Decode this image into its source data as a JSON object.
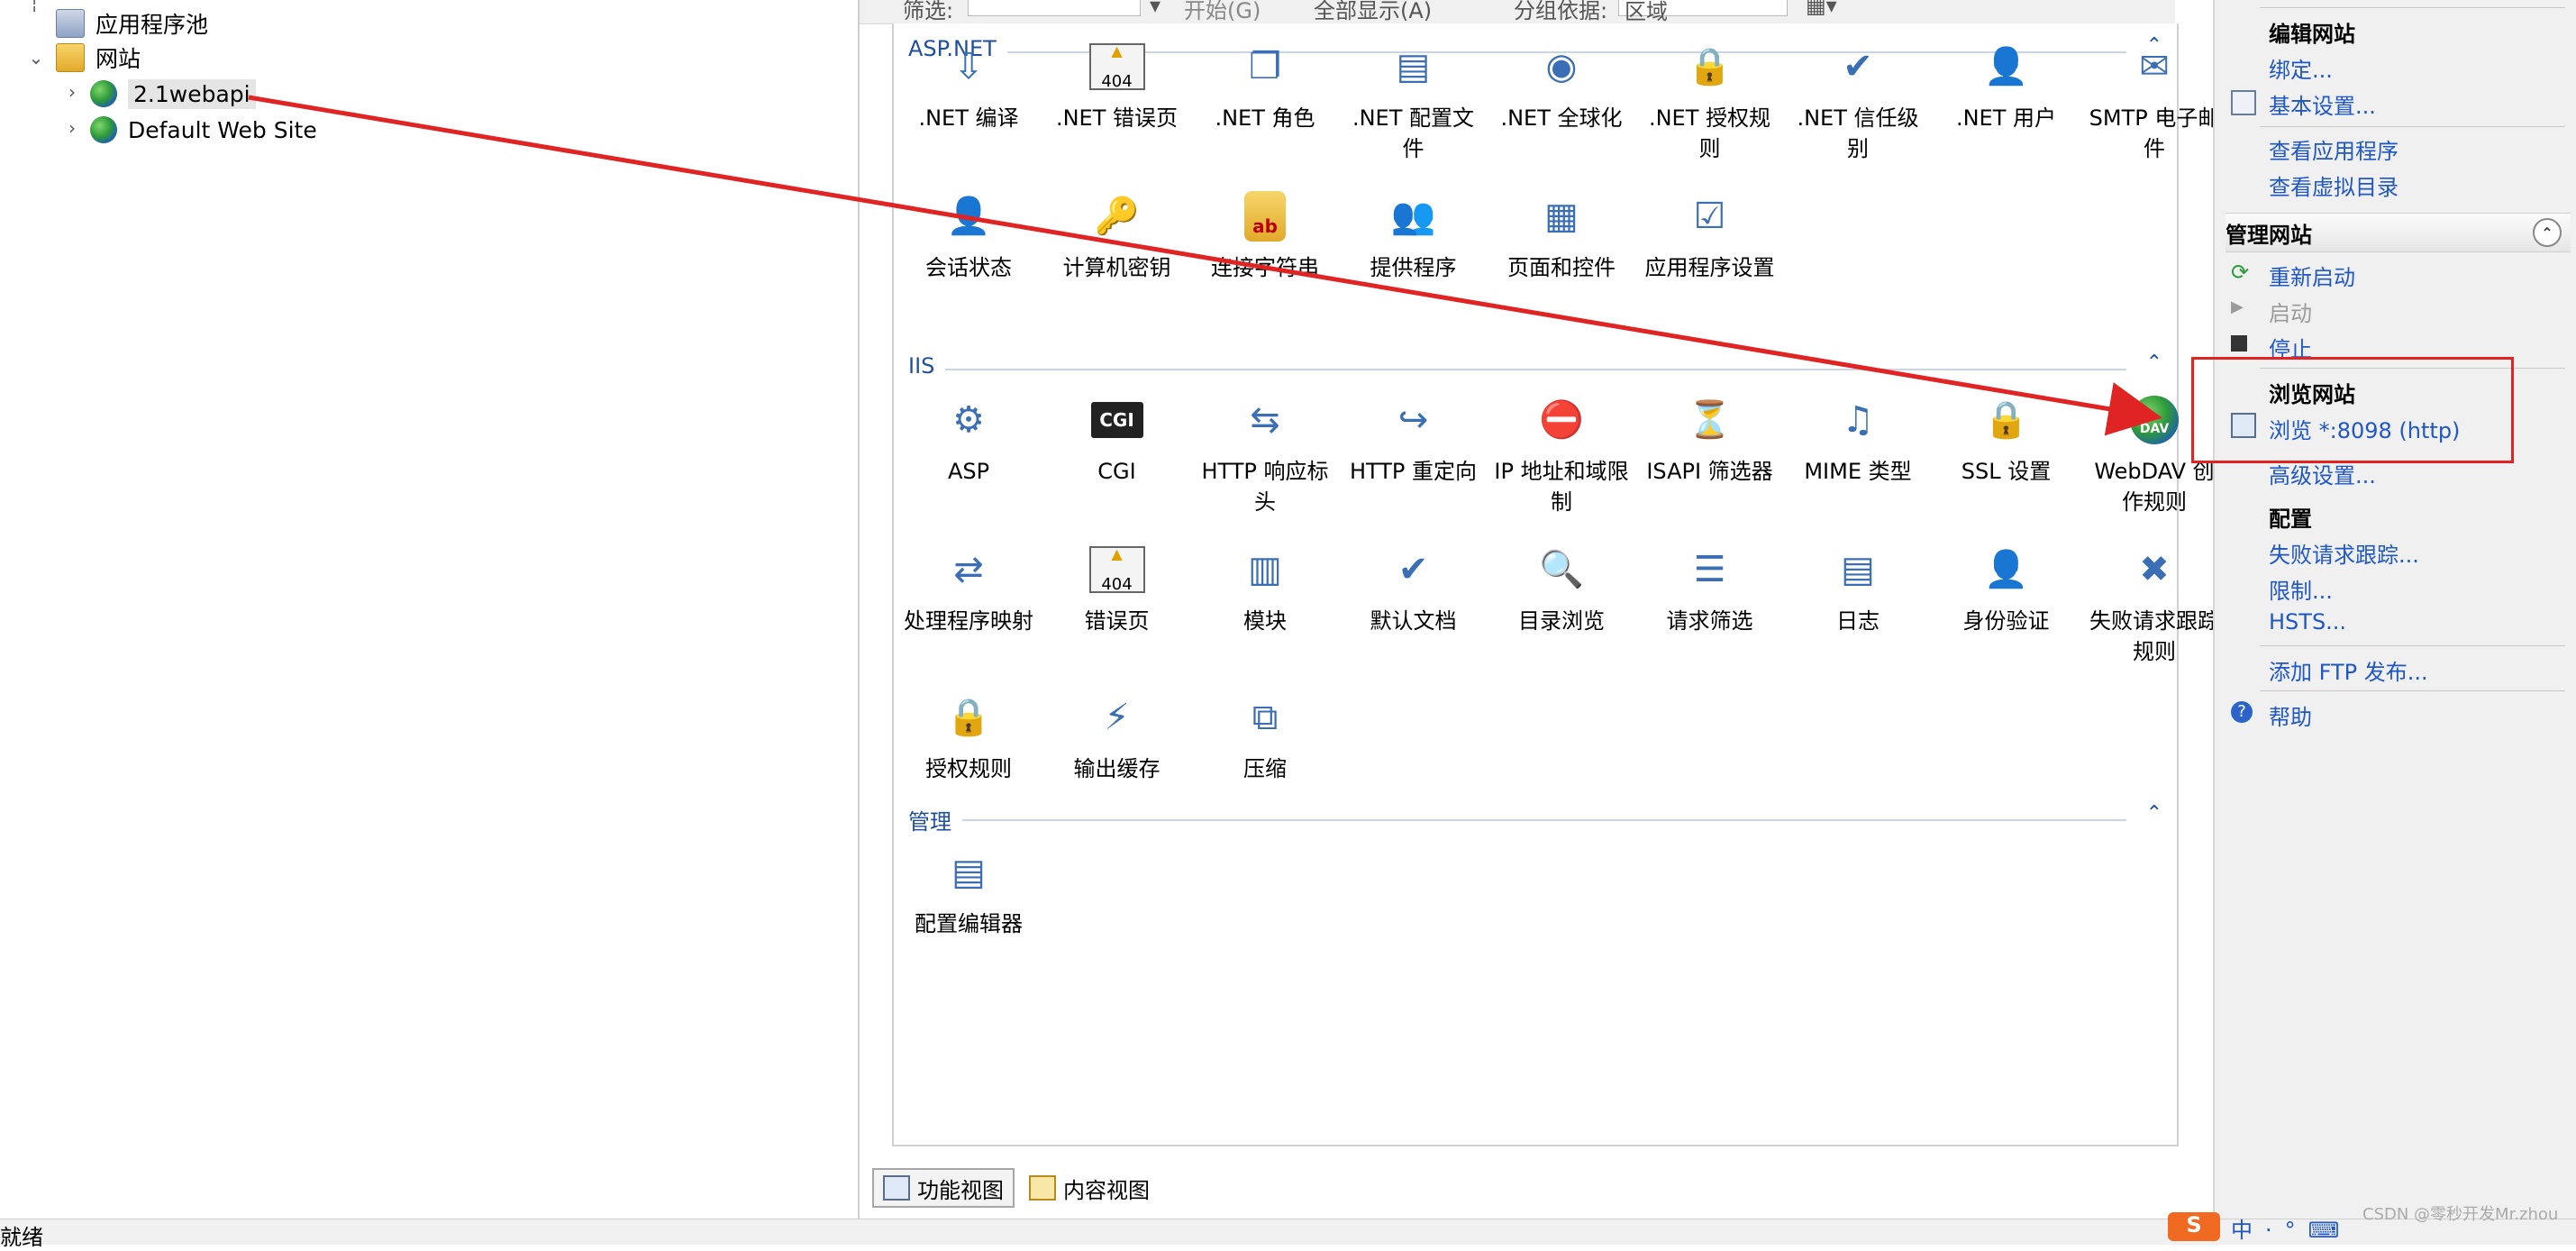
{
  "tree": {
    "items": [
      {
        "label": "应用程序池",
        "icon": "app-pool-icon"
      },
      {
        "label": "网站",
        "icon": "sites-folder-icon"
      },
      {
        "label": "2.1webapi",
        "icon": "globe-icon",
        "selected": true
      },
      {
        "label": "Default Web Site",
        "icon": "globe-icon"
      }
    ]
  },
  "toolbar": {
    "filter_label": "筛选:",
    "go_label": "开始(G)",
    "show_all_label": "全部显示(A)",
    "group_by_label": "分组依据:",
    "group_by_value": "区域"
  },
  "sections": {
    "aspnet": {
      "title": "ASP.NET",
      "items": [
        ".NET 编译",
        ".NET 错误页",
        ".NET 角色",
        ".NET 配置文件",
        ".NET 全球化",
        ".NET 授权规则",
        ".NET 信任级别",
        ".NET 用户",
        "SMTP 电子邮件",
        "会话状态",
        "计算机密钥",
        "连接字符串",
        "提供程序",
        "页面和控件",
        "应用程序设置"
      ]
    },
    "iis": {
      "title": "IIS",
      "items": [
        "ASP",
        "CGI",
        "HTTP 响应标头",
        "HTTP 重定向",
        "IP 地址和域限制",
        "ISAPI 筛选器",
        "MIME 类型",
        "SSL 设置",
        "WebDAV 创作规则",
        "处理程序映射",
        "错误页",
        "模块",
        "默认文档",
        "目录浏览",
        "请求筛选",
        "日志",
        "身份验证",
        "失败请求跟踪规则",
        "授权规则",
        "输出缓存",
        "压缩"
      ]
    },
    "management": {
      "title": "管理",
      "items": [
        "配置编辑器"
      ]
    }
  },
  "view_tabs": {
    "features": "功能视图",
    "content": "内容视图"
  },
  "actions": {
    "edit_site": "编辑网站",
    "bindings": "绑定...",
    "basic_settings": "基本设置...",
    "view_apps": "查看应用程序",
    "view_vdirs": "查看虚拟目录",
    "manage_site": "管理网站",
    "restart": "重新启动",
    "start": "启动",
    "stop": "停止",
    "browse_site": "浏览网站",
    "browse_link": "浏览 *:8098 (http)",
    "advanced_settings": "高级设置...",
    "configure": "配置",
    "failed_req": "失败请求跟踪...",
    "limits": "限制...",
    "hsts": "HSTS...",
    "add_ftp": "添加 FTP 发布...",
    "help": "帮助"
  },
  "status": {
    "text": "就绪"
  },
  "watermark": "CSDN @零秒开发Mr.zhou",
  "colors": {
    "link": "#1f57c7",
    "section_title": "#1f4f9e",
    "annotation_red": "#e02424"
  }
}
